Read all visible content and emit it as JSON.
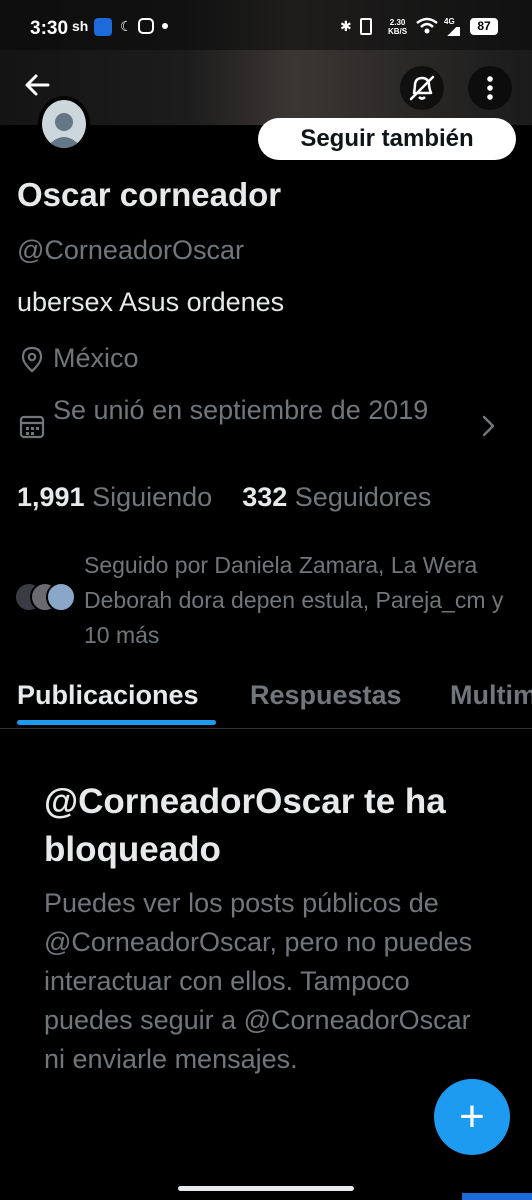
{
  "status_bar": {
    "time": "3:30",
    "speed_value": "2.30",
    "speed_unit": "KB/S",
    "network": "4G",
    "battery": "87"
  },
  "header": {
    "back_icon": "arrow-left-icon",
    "muted_icon": "bell-off-icon",
    "more_icon": "more-vertical-icon"
  },
  "profile": {
    "follow_button": "Seguir también",
    "name": "Oscar corneador",
    "handle": "@CorneadorOscar",
    "bio": "ubersex Asus ordenes",
    "location": "México",
    "joined": "Se unió en septiembre de 2019",
    "following_count": "1,991",
    "following_label": "Siguiendo",
    "followers_count": "332",
    "followers_label": "Seguidores",
    "followed_by": "Seguido por Daniela Zamara, La Wera Deborah dora depen estula, Pareja_cm y 10 más"
  },
  "tabs": [
    {
      "label": "Publicaciones",
      "active": true
    },
    {
      "label": "Respuestas",
      "active": false
    },
    {
      "label": "Multimedia",
      "active": false
    }
  ],
  "blocked": {
    "title": "@CorneadorOscar te ha bloqueado",
    "body": "Puedes ver los posts públicos de @CorneadorOscar, pero no puedes interactuar con ellos. Tampoco puedes seguir a @CorneadorOscar ni enviarle mensajes."
  },
  "fab": {
    "label": "+"
  },
  "colors": {
    "accent": "#1d9bf0",
    "background": "#000000",
    "primary_text": "#e7e9ea",
    "secondary_text": "#71767b"
  }
}
